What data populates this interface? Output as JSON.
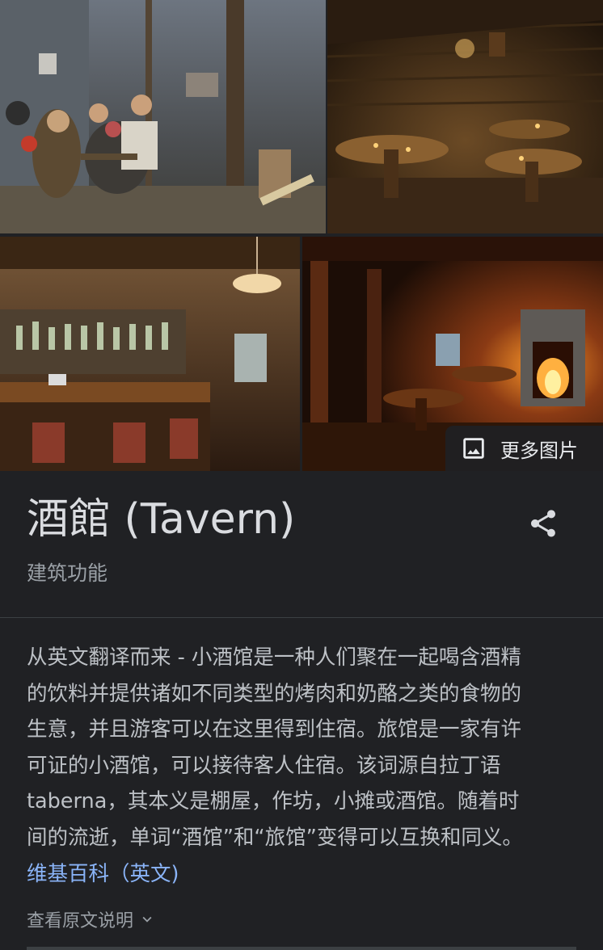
{
  "images": [
    {
      "name": "tavern-painting-image"
    },
    {
      "name": "log-cabin-tavern-image"
    },
    {
      "name": "bar-interior-image"
    },
    {
      "name": "fireplace-tavern-image"
    }
  ],
  "more_images": {
    "label": "更多图片",
    "icon": "image-icon"
  },
  "entity": {
    "title": "酒館 (Tavern)",
    "subtitle": "建筑功能",
    "share_icon": "share-icon"
  },
  "description": {
    "lines": [
      "从英文翻译而来 - 小酒馆是一种人们聚在一起喝含酒精",
      "的饮料并提供诸如不同类型的烤肉和奶酪之类的食物的",
      "生意，并且游客可以在这里得到住宿。旅馆是一家有许",
      "可证的小酒馆，可以接待客人住宿。该词源自拉丁语",
      "taberna，其本义是棚屋，作坊，小摊或酒馆。随着时",
      "间的流逝，单词“酒馆”和“旅馆”变得可以互换和同义。"
    ],
    "source_link": "维基百科（英文)"
  },
  "expand": {
    "label": "查看原文说明",
    "icon": "chevron-down-icon"
  },
  "colors": {
    "background": "#202124",
    "title": "#dadce0",
    "secondary": "#9aa0a6",
    "body": "#bdc1c6",
    "link": "#8ab4f8"
  }
}
